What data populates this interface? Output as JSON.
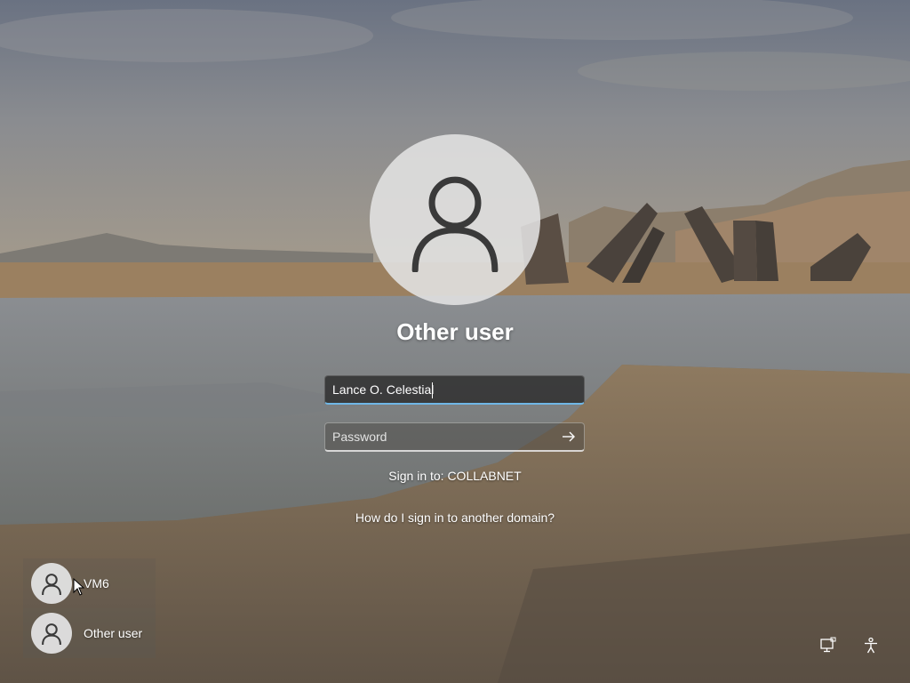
{
  "login": {
    "username_title": "Other user",
    "username_value": "Lance O. Celestial",
    "password_placeholder": "Password",
    "sign_in_to": "Sign in to: COLLABNET",
    "domain_link": "How do I sign in to another domain?"
  },
  "user_list": [
    {
      "label": "VM6"
    },
    {
      "label": "Other user"
    }
  ],
  "icons": {
    "avatar": "user-silhouette-icon",
    "submit": "arrow-right-icon",
    "network": "network-icon",
    "accessibility": "accessibility-icon"
  },
  "colors": {
    "focus_accent": "#6fb7e6",
    "text": "#ffffff",
    "avatar_bg": "#e2e2e2",
    "avatar_glyph": "#3a3a3a"
  }
}
